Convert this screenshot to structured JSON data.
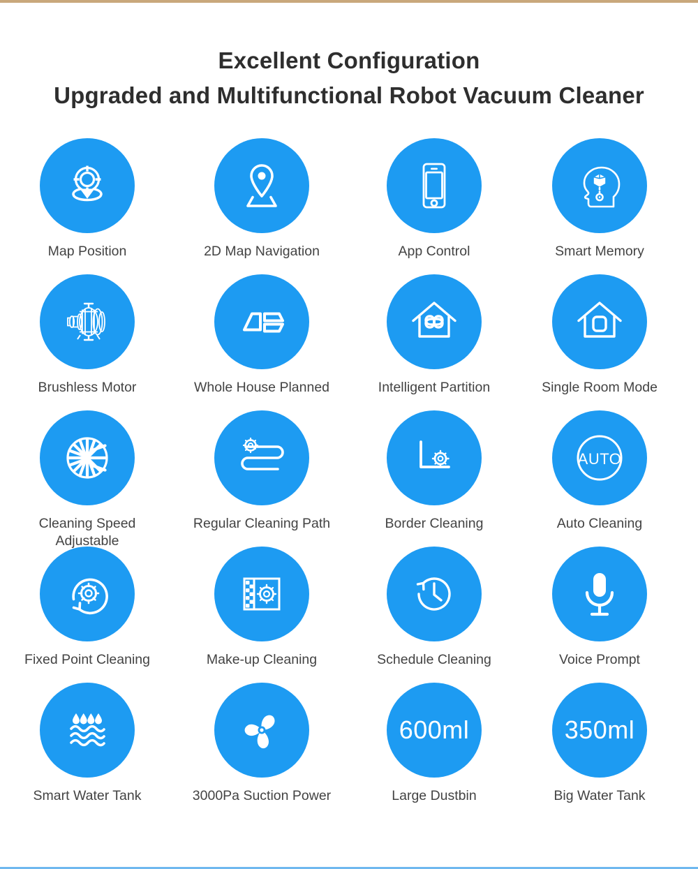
{
  "theme": {
    "accent_blue": "#1d9bf2",
    "top_rule_color": "#c9a87c",
    "bottom_rule_color": "#6fb8ef",
    "label_color": "#434343",
    "title_color": "#2e2e2e",
    "background": "#ffffff"
  },
  "header": {
    "title_line1": "Excellent Configuration",
    "title_line2": "Upgraded and Multifunctional Robot Vacuum Cleaner"
  },
  "features": [
    {
      "label": "Map Position",
      "icon": "map-position-icon"
    },
    {
      "label": "2D Map Navigation",
      "icon": "map-pin-navigation-icon"
    },
    {
      "label": "App Control",
      "icon": "smartphone-icon"
    },
    {
      "label": "Smart Memory",
      "icon": "head-memory-cube-icon"
    },
    {
      "label": "Brushless Motor",
      "icon": "brushless-motor-icon"
    },
    {
      "label": "Whole House Planned",
      "icon": "house-plan-rooms-icon"
    },
    {
      "label": "Intelligent Partition",
      "icon": "house-partition-clover-icon"
    },
    {
      "label": "Single Room Mode",
      "icon": "house-single-room-icon"
    },
    {
      "label": "Cleaning Speed\nAdjustable",
      "icon": "spoked-wheel-icon"
    },
    {
      "label": "Regular Cleaning Path",
      "icon": "serpentine-path-icon"
    },
    {
      "label": "Border Cleaning",
      "icon": "corner-border-icon"
    },
    {
      "label": "Auto Cleaning",
      "icon": "auto-circle-icon",
      "badge_text": "AUTO"
    },
    {
      "label": "Fixed Point Cleaning",
      "icon": "spiral-arrow-robot-icon"
    },
    {
      "label": "Make-up Cleaning",
      "icon": "dirty-area-robot-icon"
    },
    {
      "label": "Schedule Cleaning",
      "icon": "clock-history-icon"
    },
    {
      "label": "Voice Prompt",
      "icon": "microphone-icon"
    },
    {
      "label": "Smart Water Tank",
      "icon": "water-droplets-waves-icon"
    },
    {
      "label": "3000Pa Suction Power",
      "icon": "fan-blades-icon"
    },
    {
      "label": "Large Dustbin",
      "icon": "volume-text-icon",
      "badge_text": "600ml"
    },
    {
      "label": "Big Water Tank",
      "icon": "volume-text-icon",
      "badge_text": "350ml"
    }
  ]
}
